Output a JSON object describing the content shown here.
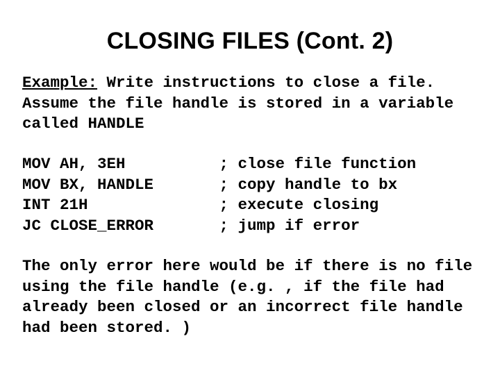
{
  "title": "CLOSING FILES (Cont. 2)",
  "example_label": "Example:",
  "example_text": " Write instructions to close a file. Assume the file handle is stored in a variable called HANDLE",
  "code": "MOV AH, 3EH          ; close file function\nMOV BX, HANDLE       ; copy handle to bx\nINT 21H              ; execute closing\nJC CLOSE_ERROR       ; jump if error",
  "footer": "The only error here would be if there is no file using the file handle (e.g. , if the file had already been closed or an incorrect file handle had been stored. )"
}
